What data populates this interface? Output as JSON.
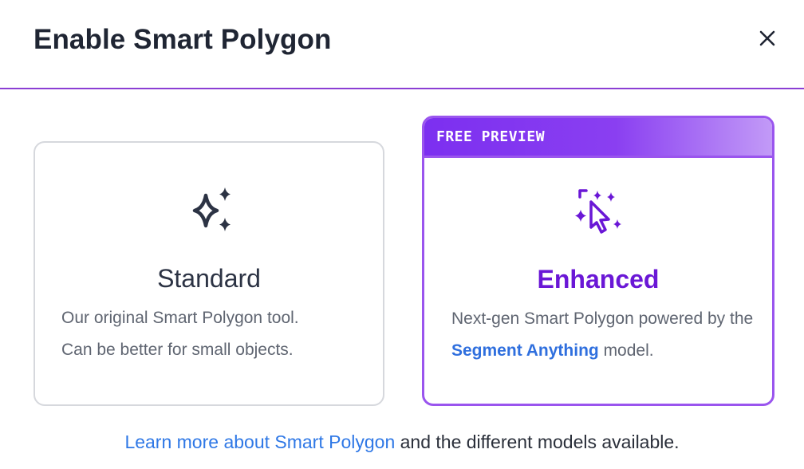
{
  "dialog": {
    "title": "Enable Smart Polygon",
    "close_icon": "close-icon"
  },
  "options": {
    "standard": {
      "icon": "sparkles-icon",
      "title": "Standard",
      "description_line1": "Our original Smart Polygon tool.",
      "description_line2": "Can be better for small objects."
    },
    "enhanced": {
      "badge": "FREE PREVIEW",
      "icon": "magic-cursor-icon",
      "title": "Enhanced",
      "description_part1": "Next-gen Smart Polygon powered by the ",
      "description_link": "Segment Anything",
      "description_part2": " model."
    }
  },
  "footer": {
    "link_text": "Learn more about Smart Polygon",
    "rest_text": " and the different models available."
  },
  "colors": {
    "accent_purple": "#6a17d6",
    "selected_border": "#9a55ee",
    "link_blue": "#2f6fde",
    "divider": "#8b3fd4"
  }
}
